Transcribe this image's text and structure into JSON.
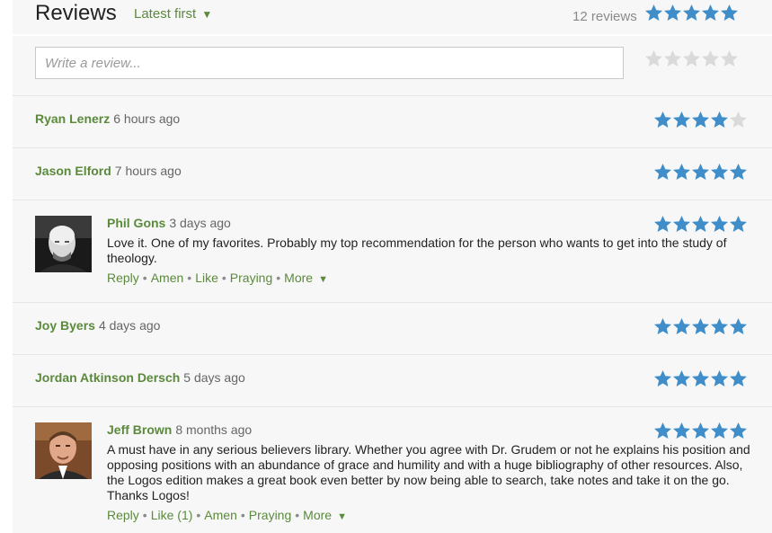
{
  "header": {
    "title": "Reviews",
    "sort_label": "Latest first",
    "sort_caret": "▼",
    "review_count": "12 reviews",
    "average_rating": 5
  },
  "compose": {
    "placeholder": "Write a review...",
    "rating": 0
  },
  "colors": {
    "star_filled": "#3f8ec9",
    "star_empty": "#dadada",
    "link_green": "#5b8a3c"
  },
  "reviews": [
    {
      "name": "Ryan Lenerz",
      "time": "6 hours ago",
      "rating": 4
    },
    {
      "name": "Jason Elford",
      "time": "7 hours ago",
      "rating": 5
    },
    {
      "name": "Phil Gons",
      "time": "3 days ago",
      "rating": 5,
      "avatar": "avatar-photo",
      "text": "Love it. One of my favorites. Probably my top recommendation for the person who wants to get into the study of theology.",
      "actions": [
        "Reply",
        "Amen",
        "Like",
        "Praying",
        "More"
      ]
    },
    {
      "name": "Joy Byers",
      "time": "4 days ago",
      "rating": 5
    },
    {
      "name": "Jordan Atkinson Dersch",
      "time": "5 days ago",
      "rating": 5
    },
    {
      "name": "Jeff Brown",
      "time": "8 months ago",
      "rating": 5,
      "avatar": "avatar-photo",
      "text": "A must have in any serious believers library. Whether you agree with Dr. Grudem or not he explains his position and opposing positions with an abundance of grace and humility and with a huge bibliography of other resources. Also, the Logos edition makes a great book even better by now being able to search, take notes and take it on the go. Thanks Logos!",
      "actions": [
        "Reply",
        "Like (1)",
        "Amen",
        "Praying",
        "More"
      ]
    }
  ]
}
